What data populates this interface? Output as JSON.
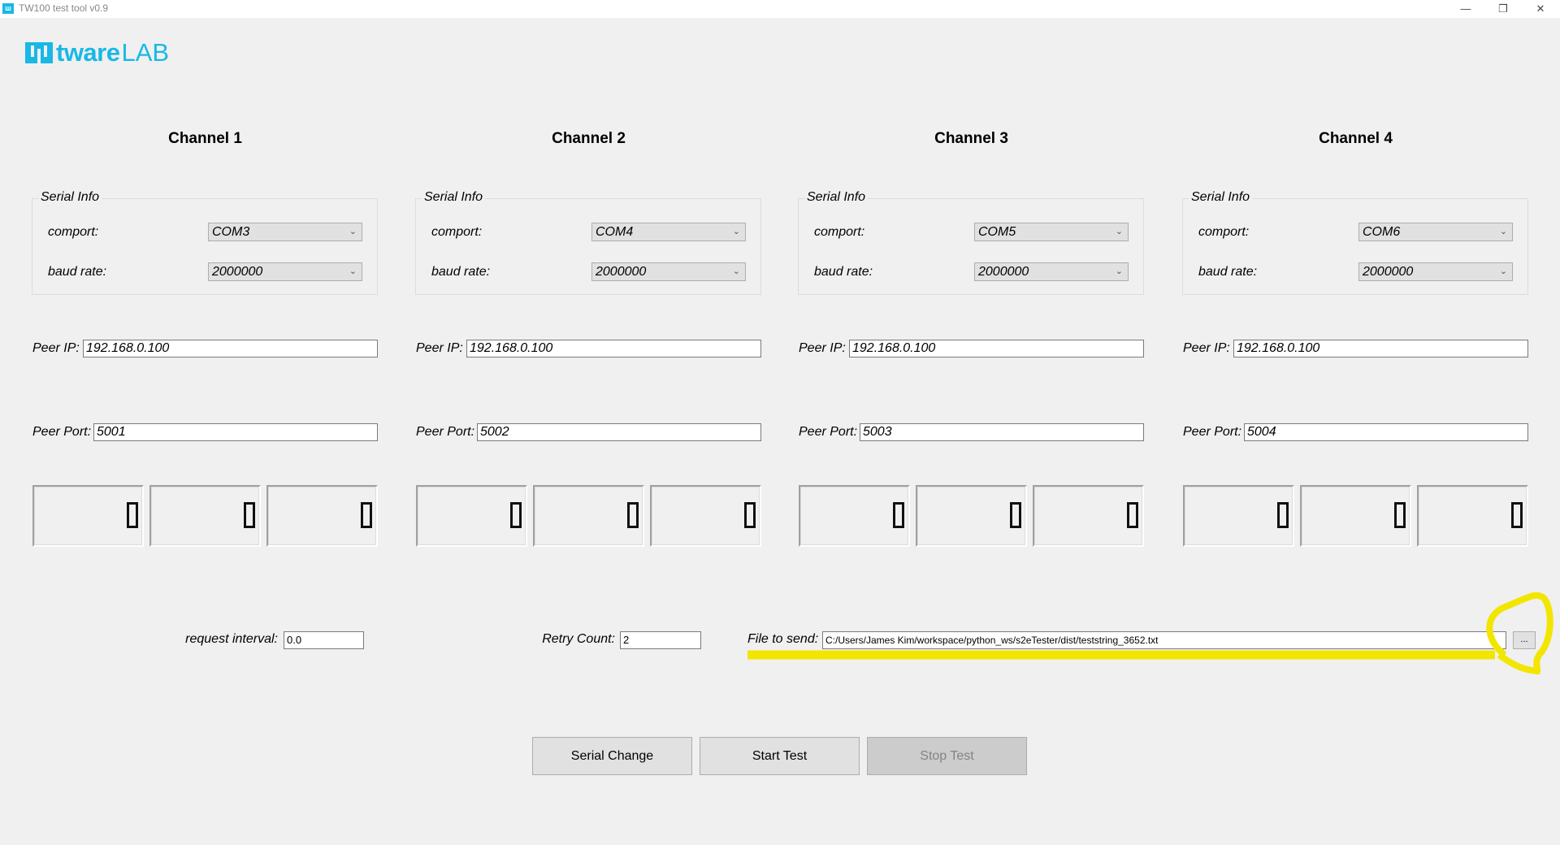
{
  "window": {
    "title": "TW100 test tool v0.9",
    "app_icon": "tw-logo-icon",
    "controls": [
      "minimize",
      "restore",
      "close"
    ]
  },
  "logo": {
    "text_bold": "tware",
    "text_light": "LAB",
    "color": "#19b8e6"
  },
  "channels": [
    {
      "title": "Channel 1",
      "group_label": "Serial Info",
      "comport_label": "comport:",
      "comport": "COM3",
      "baud_label": "baud rate:",
      "baud": "2000000",
      "peer_ip_label": "Peer IP:",
      "peer_ip": "192.168.0.100",
      "peer_port_label": "Peer Port:",
      "peer_port": "5001",
      "counters": [
        "0",
        "0",
        "0"
      ]
    },
    {
      "title": "Channel 2",
      "group_label": "Serial Info",
      "comport_label": "comport:",
      "comport": "COM4",
      "baud_label": "baud rate:",
      "baud": "2000000",
      "peer_ip_label": "Peer IP:",
      "peer_ip": "192.168.0.100",
      "peer_port_label": "Peer Port:",
      "peer_port": "5002",
      "counters": [
        "0",
        "0",
        "0"
      ]
    },
    {
      "title": "Channel 3",
      "group_label": "Serial Info",
      "comport_label": "comport:",
      "comport": "COM5",
      "baud_label": "baud rate:",
      "baud": "2000000",
      "peer_ip_label": "Peer IP:",
      "peer_ip": "192.168.0.100",
      "peer_port_label": "Peer Port:",
      "peer_port": "5003",
      "counters": [
        "0",
        "0",
        "0"
      ]
    },
    {
      "title": "Channel 4",
      "group_label": "Serial Info",
      "comport_label": "comport:",
      "comport": "COM6",
      "baud_label": "baud rate:",
      "baud": "2000000",
      "peer_ip_label": "Peer IP:",
      "peer_ip": "192.168.0.100",
      "peer_port_label": "Peer Port:",
      "peer_port": "5004",
      "counters": [
        "0",
        "0",
        "0"
      ]
    }
  ],
  "settings": {
    "request_interval_label": "request interval:",
    "request_interval": "0.0",
    "retry_count_label": "Retry Count:",
    "retry_count": "2",
    "file_label": "File to send:",
    "file_path": "C:/Users/James Kim/workspace/python_ws/s2eTester/dist/teststring_3652.txt",
    "browse_label": "..."
  },
  "buttons": {
    "serial_change": "Serial Change",
    "start_test": "Start Test",
    "stop_test": "Stop Test"
  },
  "annotation": {
    "color": "#f2e600"
  }
}
